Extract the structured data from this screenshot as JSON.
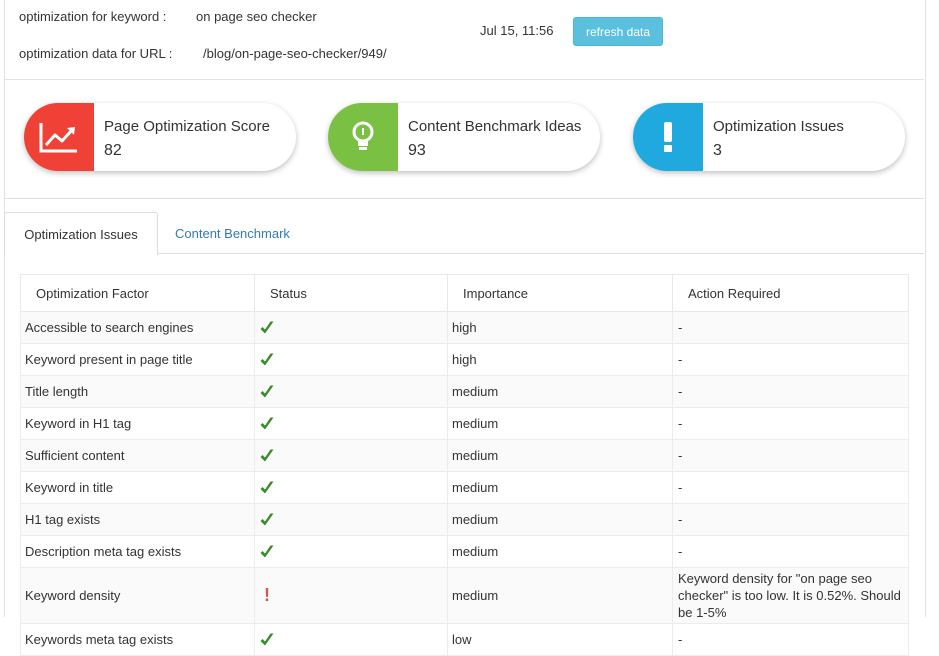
{
  "header": {
    "keyword_label": "optimization for keyword :",
    "keyword_value": "on page seo checker",
    "url_label": "optimization data for URL :",
    "url_value": "/blog/on-page-seo-checker/949/",
    "timestamp": "Jul 15, 11:56",
    "refresh_label": "refresh data"
  },
  "cards": [
    {
      "title": "Page Optimization Score",
      "value": "82",
      "color": "#ef4136",
      "icon": "trending-up-icon"
    },
    {
      "title": "Content Benchmark Ideas",
      "value": "93",
      "color": "#7ac143",
      "icon": "lightbulb-icon"
    },
    {
      "title": "Optimization Issues",
      "value": "3",
      "color": "#1fa9df",
      "icon": "exclamation-icon"
    }
  ],
  "tabs": [
    "Optimization Issues",
    "Content Benchmark"
  ],
  "table": {
    "headers": [
      "Optimization Factor",
      "Status",
      "Importance",
      "Action Required"
    ],
    "rows": [
      {
        "factor": "Accessible to search engines",
        "status": "ok",
        "importance": "high",
        "action": "-"
      },
      {
        "factor": "Keyword present in page title",
        "status": "ok",
        "importance": "high",
        "action": "-"
      },
      {
        "factor": "Title length",
        "status": "ok",
        "importance": "medium",
        "action": "-"
      },
      {
        "factor": "Keyword in H1 tag",
        "status": "ok",
        "importance": "medium",
        "action": "-"
      },
      {
        "factor": "Sufficient content",
        "status": "ok",
        "importance": "medium",
        "action": "-"
      },
      {
        "factor": "Keyword in title",
        "status": "ok",
        "importance": "medium",
        "action": "-"
      },
      {
        "factor": "H1 tag exists",
        "status": "ok",
        "importance": "medium",
        "action": "-"
      },
      {
        "factor": "Description meta tag exists",
        "status": "ok",
        "importance": "medium",
        "action": "-"
      },
      {
        "factor": "Keyword density",
        "status": "warning",
        "status_text": "!",
        "importance": "medium",
        "action": "Keyword density for \"on page seo checker\" is too low. It is 0.52%. Should be 1-5%"
      },
      {
        "factor": "Keywords meta tag exists",
        "status": "ok",
        "importance": "low",
        "action": "-"
      }
    ]
  }
}
